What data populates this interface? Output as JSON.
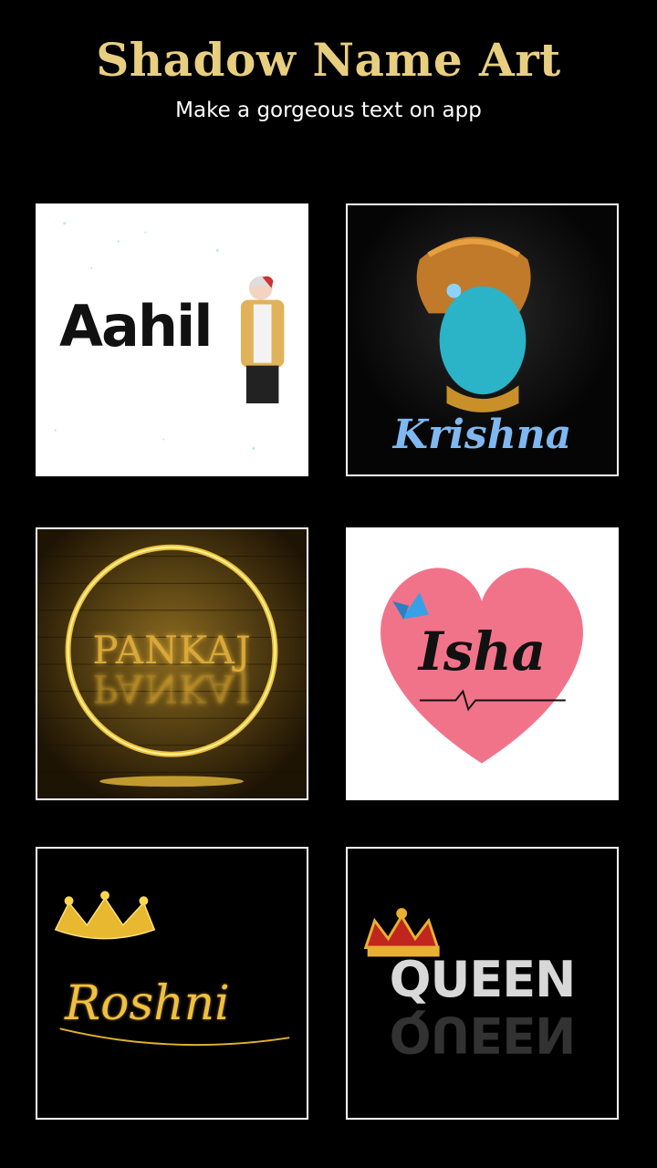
{
  "header": {
    "title": "Shadow Name Art",
    "subtitle": "Make a gorgeous text on app"
  },
  "templates": [
    {
      "name": "Aahil"
    },
    {
      "name": "Krishna"
    },
    {
      "name": "PANKAJ"
    },
    {
      "name": "Isha"
    },
    {
      "name": "Roshni"
    },
    {
      "name": "QUEEN"
    }
  ],
  "colors": {
    "background": "#000000",
    "title": "#e8cf80",
    "card_border": "#ffffff"
  }
}
